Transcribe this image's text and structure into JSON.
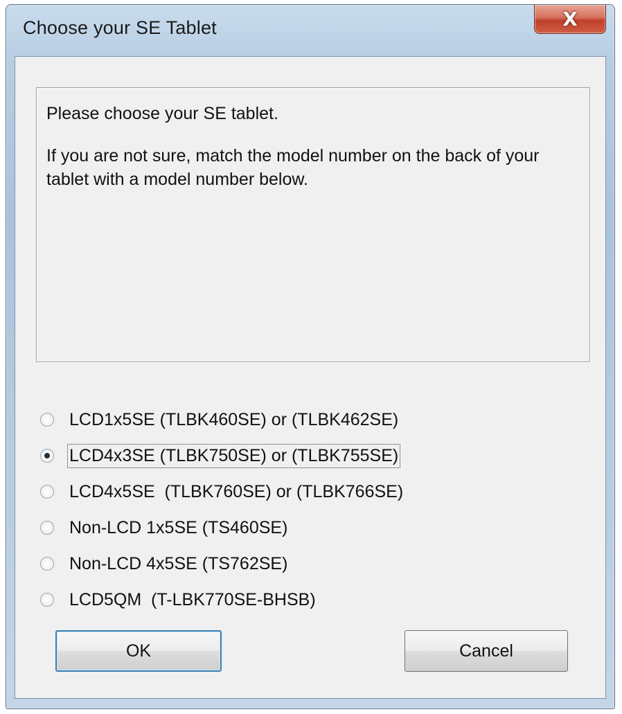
{
  "window": {
    "title": "Choose your SE Tablet",
    "close_glyph": "X"
  },
  "info": {
    "line1": "Please choose your SE tablet.",
    "line2": "If you are not sure, match the model number on the back of your tablet with a model number below."
  },
  "options": [
    {
      "label": "LCD1x5SE (TLBK460SE) or (TLBK462SE)",
      "selected": false
    },
    {
      "label": "LCD4x3SE (TLBK750SE) or (TLBK755SE)",
      "selected": true
    },
    {
      "label": "LCD4x5SE  (TLBK760SE) or (TLBK766SE)",
      "selected": false
    },
    {
      "label": "Non-LCD 1x5SE (TS460SE)",
      "selected": false
    },
    {
      "label": "Non-LCD 4x5SE (TS762SE)",
      "selected": false
    },
    {
      "label": "LCD5QM  (T-LBK770SE-BHSB)",
      "selected": false
    }
  ],
  "buttons": {
    "ok_label": "OK",
    "cancel_label": "Cancel"
  },
  "colors": {
    "close_button": "#c0402a",
    "default_button_border": "#3c7fb1",
    "dialog_background": "#f0f0f0"
  }
}
